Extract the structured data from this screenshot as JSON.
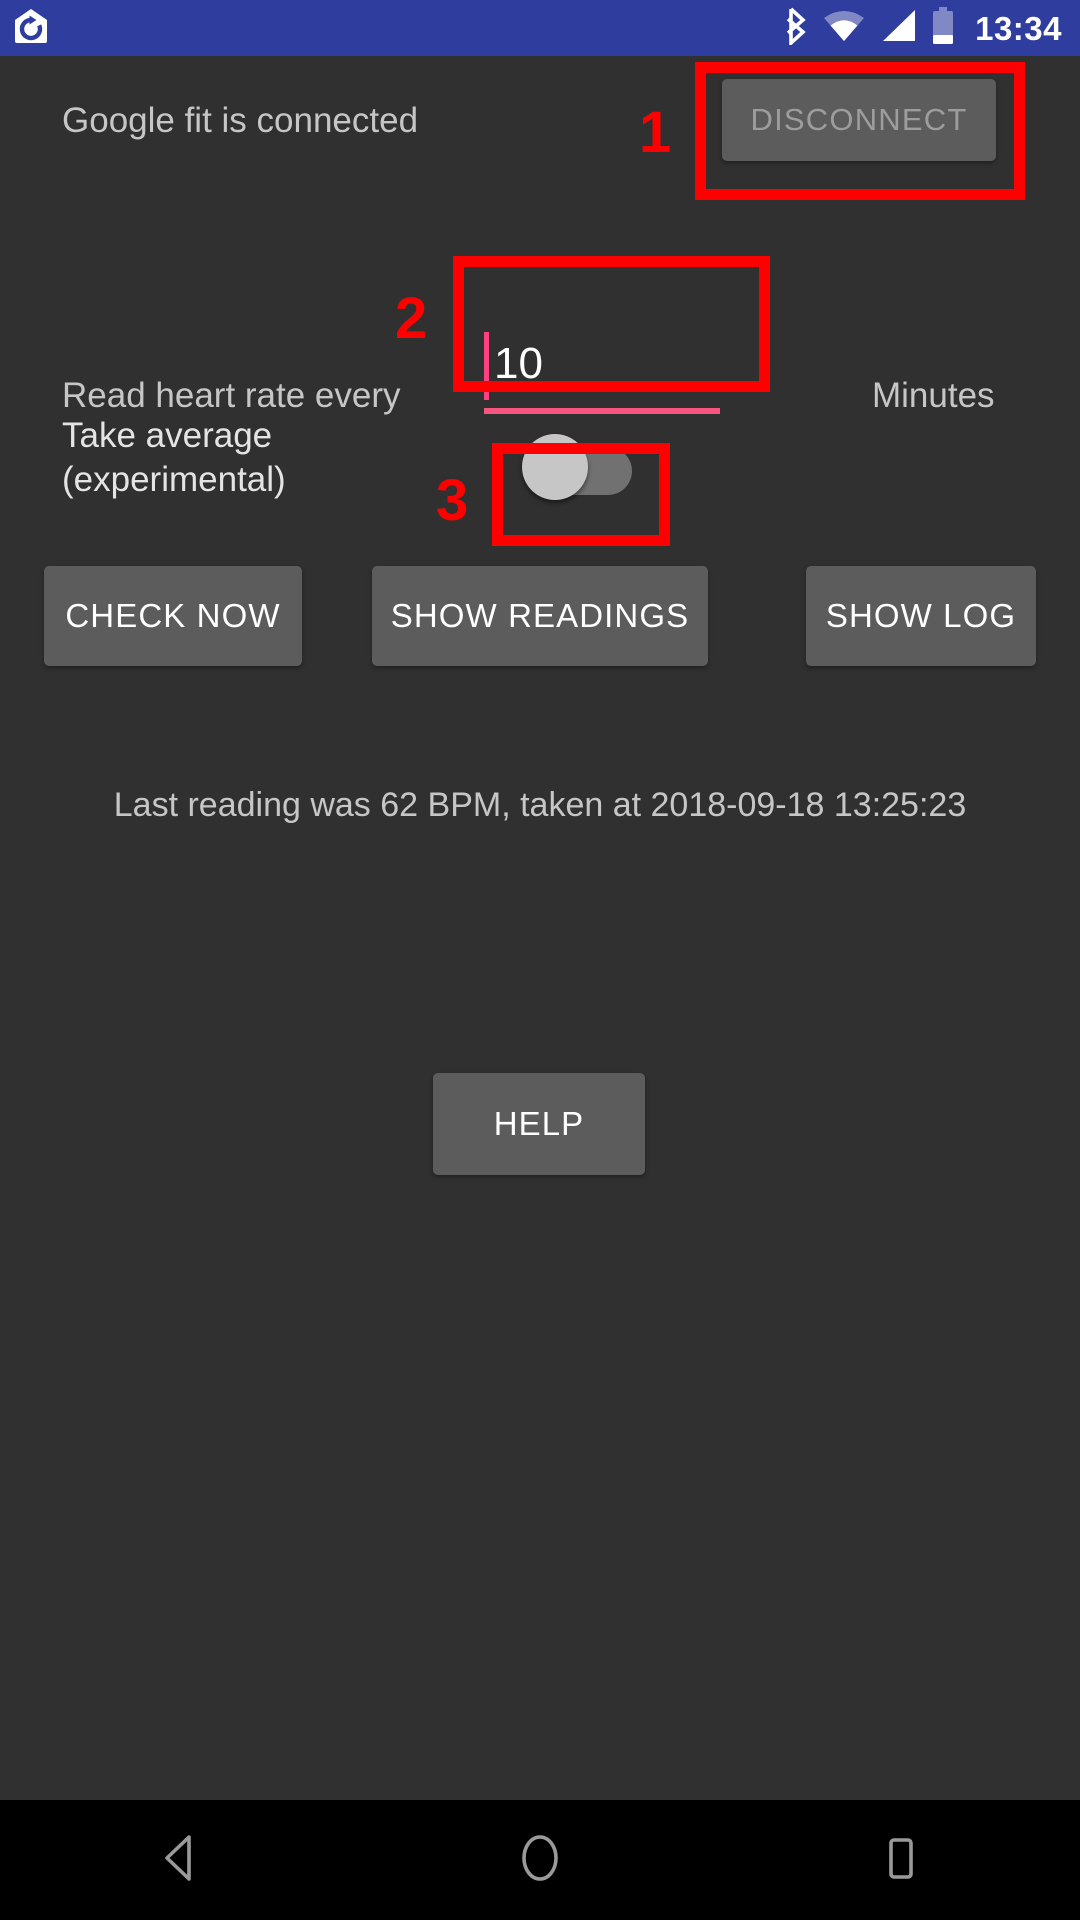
{
  "status_bar": {
    "app_icon": "house-refresh-icon",
    "icons": [
      "bluetooth-icon",
      "wifi-icon",
      "cell-signal-icon",
      "battery-icon"
    ],
    "clock": "13:34",
    "background_color": "#2e3d9e"
  },
  "screen": {
    "background_color": "#303030",
    "accent_color": "#ff4081"
  },
  "fit_row": {
    "status_label": "Google fit is connected",
    "disconnect_label": "DISCONNECT"
  },
  "interval_row": {
    "prefix_label": "Read heart rate every",
    "value": "10",
    "placeholder": "10",
    "suffix_label": "Minutes"
  },
  "average_row": {
    "label": "Take average\n(experimental)",
    "label_line1": "Take average",
    "label_line2": "(experimental)",
    "switch_state": "off"
  },
  "actions": {
    "check_now_label": "CHECK NOW",
    "show_readings_label": "SHOW READINGS",
    "show_log_label": "SHOW LOG"
  },
  "status": {
    "last_reading_label": "Last reading was 62 BPM, taken at 2018-09-18 13:25:23",
    "bpm": "62",
    "taken_at": "2018-09-18 13:25:23"
  },
  "help": {
    "label": "HELP"
  },
  "nav_bar": {
    "back_icon": "back-triangle-icon",
    "home_icon": "home-circle-icon",
    "recents_icon": "recents-square-icon"
  },
  "annotations": {
    "color": "#ff0000",
    "items": [
      {
        "number": "1",
        "target": "disconnect-button"
      },
      {
        "number": "2",
        "target": "interval-input"
      },
      {
        "number": "3",
        "target": "average-switch"
      }
    ]
  }
}
